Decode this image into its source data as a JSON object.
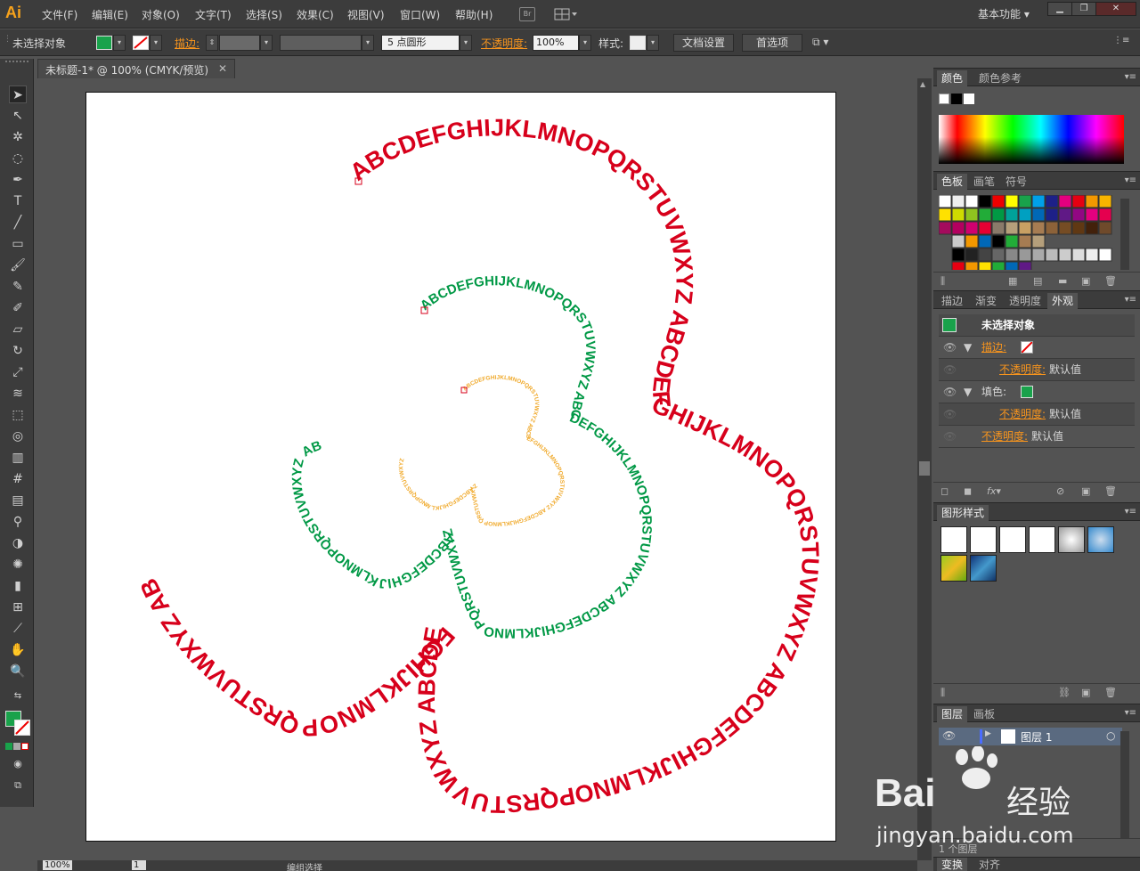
{
  "app": {
    "logo": "Ai",
    "workspace": "基本功能"
  },
  "menu": [
    "文件(F)",
    "编辑(E)",
    "对象(O)",
    "文字(T)",
    "选择(S)",
    "效果(C)",
    "视图(V)",
    "窗口(W)",
    "帮助(H)"
  ],
  "menu_icons": {
    "bridge": "Br",
    "arrange": "arrange-documents-icon"
  },
  "window_buttons": [
    "minimize",
    "restore",
    "close"
  ],
  "control": {
    "selection": "未选择对象",
    "fill_color": "#19a24b",
    "stroke_label": "描边:",
    "brush": "5 点圆形",
    "opacity_label": "不透明度:",
    "opacity_value": "100%",
    "style_label": "样式:",
    "doc_settings": "文档设置",
    "preferences": "首选项"
  },
  "document": {
    "tab_title": "未标题-1* @ 100% (CMYK/预览)",
    "zoom": "100%",
    "page": "1",
    "status": "编组选择"
  },
  "artwork": {
    "outer_text": "ABCDEFGHIJKLMNOPQRSTUVWXYZ ABCDEFGHIJKLMNOPQRSTUVWXYZ ABCDEFGHIJKLMNOPQRSTUVWXYZ ABCDEFGHIJKLMNOPQRSTUVWXYZ AB",
    "mid_text": "ABCDEFGHIJKLMNOPQRSTUVWXYZ ABCDEFGHIJKLMNOPQRSTUVWXYZ ABCDEFGHIJKLMNOPQRSTUVWXYZ ABCDEFGHIJKLMNOPQRSTUVWXYZ AB",
    "inner_text": "ABCDEFGHIJKLMNOPQRSTUVWXYZ ABCDEFGHIJKLMNOPQRSTUVWXYZ ABCDEFGHIJKLMNOPQRSTUVWXYZ ABCDEFGHIJKLMNOPQRSTUVWXYZ",
    "colors": {
      "outer": "#d7001b",
      "mid": "#009845",
      "inner": "#f0a92a"
    }
  },
  "panels": {
    "color": {
      "tabs": [
        "颜色",
        "颜色参考"
      ]
    },
    "swatches": {
      "tabs": [
        "色板",
        "画笔",
        "符号"
      ]
    },
    "appearance": {
      "tabs": [
        "描边",
        "渐变",
        "透明度",
        "外观"
      ],
      "title": "未选择对象",
      "rows": [
        {
          "label": "描边:",
          "value": ""
        },
        {
          "label": "不透明度:",
          "value": "默认值"
        },
        {
          "label": "填色:",
          "value": ""
        },
        {
          "label": "不透明度:",
          "value": "默认值"
        },
        {
          "label": "不透明度:",
          "value": "默认值"
        }
      ]
    },
    "graphic_styles": {
      "tabs": [
        "图形样式"
      ]
    },
    "layers": {
      "tabs": [
        "图层",
        "画板"
      ],
      "layer_name": "图层 1",
      "count": "1 个图层"
    },
    "transform": {
      "tabs": [
        "变换",
        "对齐"
      ]
    }
  },
  "watermark": {
    "brand": "Bai",
    "brand2": "经验",
    "url": "jingyan.baidu.com"
  }
}
